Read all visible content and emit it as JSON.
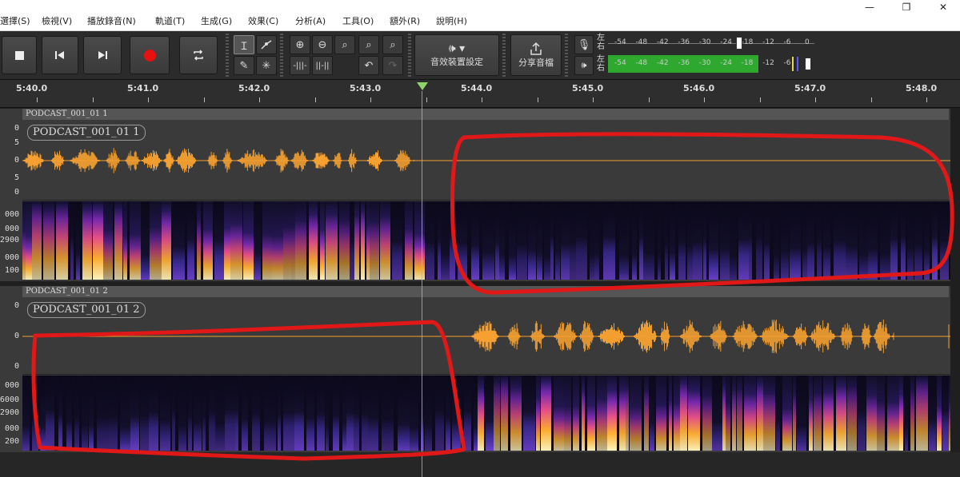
{
  "window": {
    "minimize_icon": "minimize-icon",
    "restore_icon": "restore-icon",
    "close_icon": "close-icon",
    "minimize_glyph": "—",
    "restore_glyph": "❐",
    "close_glyph": "✕"
  },
  "menu": [
    "選擇(S)",
    "檢視(V)",
    "播放錄音(N)",
    "軌道(T)",
    "生成(G)",
    "效果(C)",
    "分析(A)",
    "工具(O)",
    "額外(R)",
    "說明(H)"
  ],
  "toolbar": {
    "stop_icon": "stop-icon",
    "skip_start_icon": "skip-to-start-icon",
    "skip_end_icon": "skip-to-end-icon",
    "record_icon": "record-icon",
    "loop_icon": "loop-icon",
    "audio_setup_label": "音效裝置設定",
    "share_audio_label": "分享音檔",
    "record_color": "#e81010"
  },
  "meters": {
    "left_label": "左",
    "right_label": "右",
    "scale": [
      "-54",
      "-48",
      "-42",
      "-36",
      "-30",
      "-24",
      "-18",
      "-12",
      "-6",
      "0"
    ],
    "record_meter_level": 0,
    "playback_meter_level": 0.89,
    "level_color": "#2ea82e"
  },
  "timeline": {
    "ticks": [
      "5:40.0",
      "5:41.0",
      "5:42.0",
      "5:43.0",
      "5:44.0",
      "5:45.0",
      "5:46.0",
      "5:47.0",
      "5:48.0"
    ],
    "playhead_time": "5:43.5"
  },
  "tracks": [
    {
      "header": "PODCAST_001_01 1",
      "name": "PODCAST_001_01 1",
      "wave_labels": [
        "0",
        "5",
        "0",
        "5",
        "0"
      ],
      "spec_labels": [
        "000",
        "000",
        "2900",
        "000",
        "100"
      ],
      "speech_region": "5:40.0 – 5:43.5"
    },
    {
      "header": "PODCAST_001_01 2",
      "name": "PODCAST_001_01 2",
      "wave_labels": [
        "0",
        "0",
        "0"
      ],
      "spec_labels": [
        "000",
        "6000",
        "2900",
        "000",
        "200"
      ],
      "speech_region": "5:43.9 – 5:48.0"
    }
  ],
  "colors": {
    "waveform": "#f5a030",
    "annotation": "#e01818",
    "playhead": "#8ed46a"
  }
}
